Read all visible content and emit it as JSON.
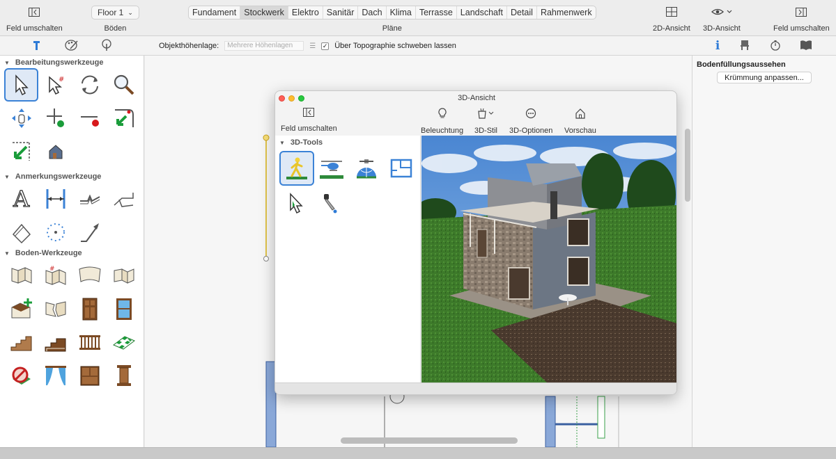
{
  "toolbar": {
    "left_toggle": "Feld umschalten",
    "floor_value": "Floor 1",
    "floors_label": "Böden",
    "plans_label": "Pläne",
    "plans": [
      "Fundament",
      "Stockwerk",
      "Elektro",
      "Sanitär",
      "Dach",
      "Klima",
      "Terrasse",
      "Landschaft",
      "Detail",
      "Rahmenwerk"
    ],
    "active_plan": "Stockwerk",
    "view2d": "2D-Ansicht",
    "view3d": "3D-Ansicht",
    "right_toggle": "Feld umschalten"
  },
  "subbar": {
    "height_label": "Objekthöhenlage:",
    "height_placeholder": "Mehrere Höhenlagen",
    "float_label": "Über Topographie schweben lassen",
    "float_checked": true
  },
  "palette": {
    "sections": [
      {
        "title": "Bearbeitungswerkzeuge",
        "tools": [
          "select-arrow",
          "select-hash",
          "rotate",
          "zoom",
          "move-hand",
          "add-point",
          "remove-point",
          "corner-green",
          "corner-green-2",
          "house-small"
        ]
      },
      {
        "title": "Anmerkungswerkzeuge",
        "tools": [
          "text",
          "dimension",
          "break-line",
          "callout",
          "angle-dim",
          "circle-dots",
          "arrow-line"
        ]
      },
      {
        "title": "Boden-Werkzeuge",
        "tools": [
          "wall",
          "wall-hash",
          "curved-wall",
          "wall-2",
          "add-room",
          "broken-wall",
          "door",
          "window",
          "stairs",
          "stair-box",
          "railing",
          "checker",
          "no-sign",
          "curtain",
          "cabinet",
          "column"
        ]
      }
    ]
  },
  "inspector": {
    "title": "Bodenfüllungsaussehen",
    "button": "Krümmung anpassen..."
  },
  "window3d": {
    "title": "3D-Ansicht",
    "toggle": "Feld umschalten",
    "lighting": "Beleuchtung",
    "style": "3D-Stil",
    "options": "3D-Optionen",
    "preview": "Vorschau",
    "tools_title": "3D-Tools",
    "tools": [
      "walk-tool",
      "helicopter-tool",
      "globe-tool",
      "plan-tool",
      "pointer-tool",
      "eyedropper-tool"
    ]
  },
  "colors": {
    "accent": "#3b82d6",
    "grass": "#3d7a2a",
    "sky": "#5a8fd4"
  }
}
